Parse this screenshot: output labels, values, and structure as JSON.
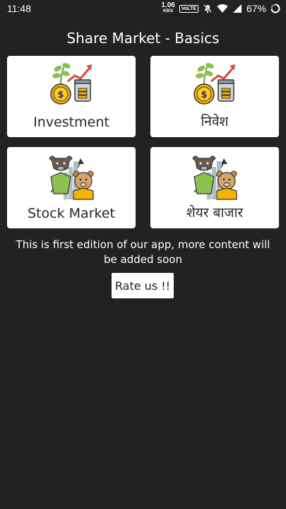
{
  "status_bar": {
    "time": "11:48",
    "speed_value": "1.06",
    "speed_unit": "KB/S",
    "network_badge": "VoLTE",
    "battery_percent": "67%",
    "icons": [
      "mute-icon",
      "wifi-icon",
      "signal-icon",
      "battery-icon"
    ]
  },
  "header": {
    "title": "Share Market - Basics"
  },
  "cards": [
    {
      "label": "Investment",
      "icon": "investment-plant-coins-icon"
    },
    {
      "label": "निवेश",
      "icon": "investment-plant-coins-icon"
    },
    {
      "label": "Stock Market",
      "icon": "bull-bear-market-icon"
    },
    {
      "label": "शेयर बाजार",
      "icon": "bull-bear-market-icon"
    }
  ],
  "footer": {
    "note": "This is first edition of our app, more content will be added soon",
    "rate_button": "Rate us !!"
  },
  "colors": {
    "background": "#232123",
    "card": "#ffffff",
    "text": "#ffffff"
  }
}
